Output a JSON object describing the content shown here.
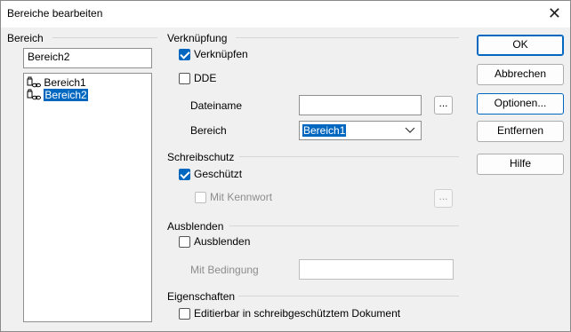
{
  "window": {
    "title": "Bereiche bearbeiten",
    "close": "✕"
  },
  "left": {
    "label": "Bereich",
    "name_value": "Bereich2",
    "items": [
      {
        "label": "Bereich1",
        "selected": false
      },
      {
        "label": "Bereich2",
        "selected": true
      }
    ]
  },
  "link": {
    "section": "Verknüpfung",
    "verknuepfen": "Verknüpfen",
    "dde": "DDE",
    "dateiname_label": "Dateiname",
    "dateiname_value": "",
    "bereich_label": "Bereich",
    "bereich_value": "Bereich1",
    "browse": "..."
  },
  "protect": {
    "section": "Schreibschutz",
    "geschuetzt": "Geschützt",
    "kennwort": "Mit Kennwort",
    "kennwort_btn": "..."
  },
  "hide": {
    "section": "Ausblenden",
    "ausblenden": "Ausblenden",
    "bedingung_label": "Mit Bedingung",
    "bedingung_value": ""
  },
  "props": {
    "section": "Eigenschaften",
    "editierbar": "Editierbar in schreibgeschütztem Dokument"
  },
  "buttons": {
    "ok": "OK",
    "abbrechen": "Abbrechen",
    "optionen": "Optionen...",
    "entfernen": "Entfernen",
    "hilfe": "Hilfe"
  },
  "colors": {
    "accent": "#0067c0",
    "background": "#f0f0f0"
  }
}
